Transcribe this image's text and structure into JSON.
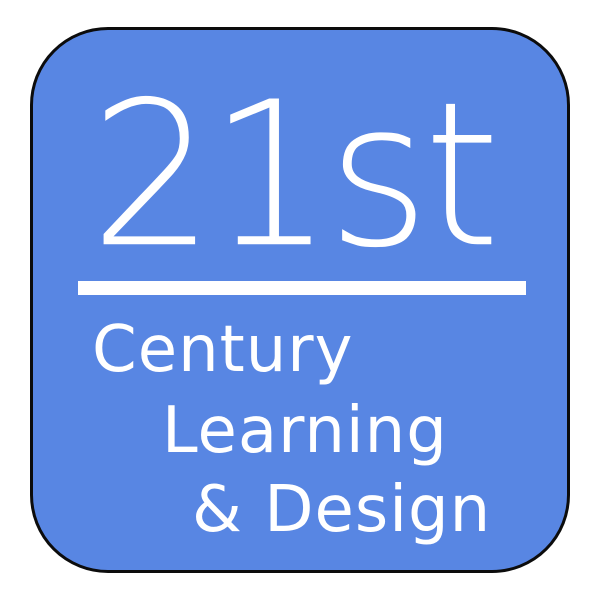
{
  "logo": {
    "number": "21st",
    "line1": "Century",
    "line2": "Learning",
    "line3": "& Design",
    "colors": {
      "tile": "#5886e3",
      "border": "#0c0c0c",
      "text": "#ffffff"
    }
  }
}
